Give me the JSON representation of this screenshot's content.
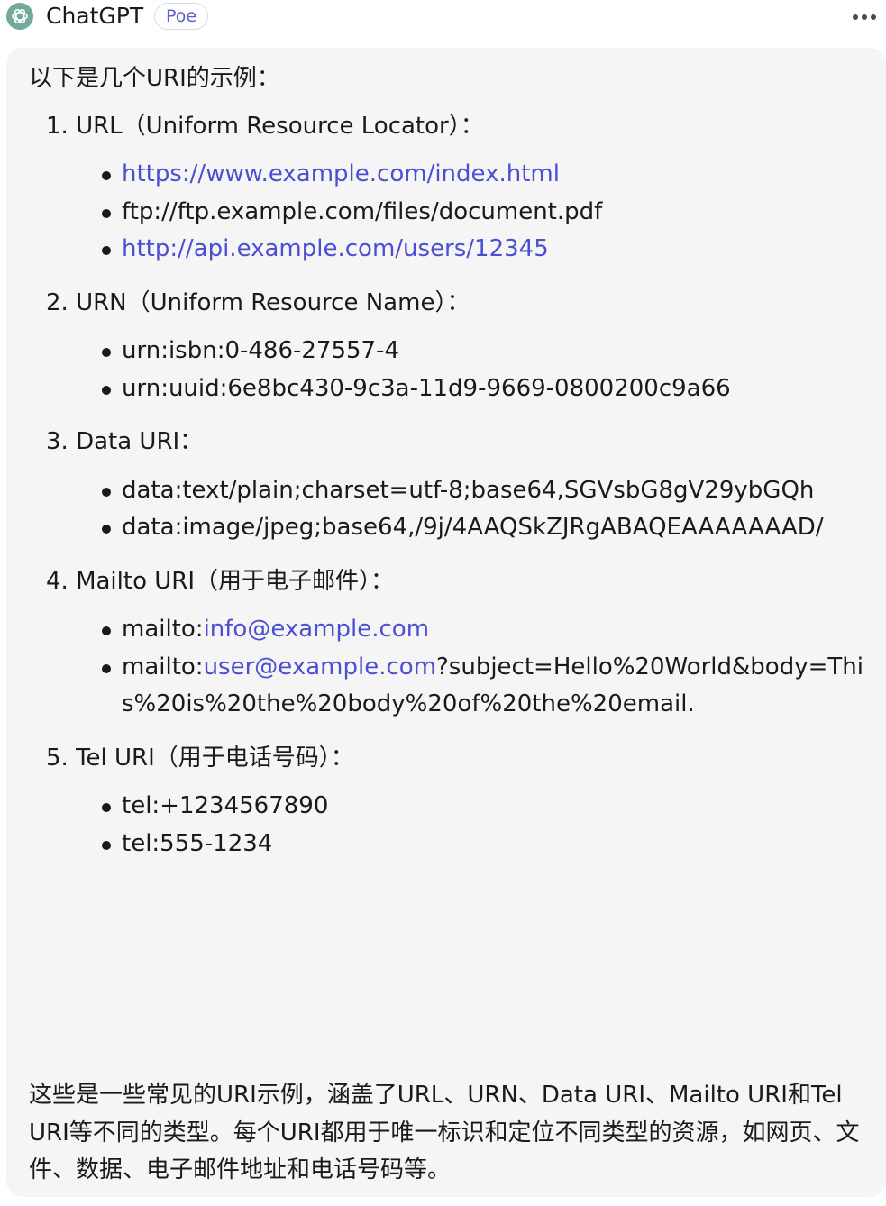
{
  "header": {
    "bot_name": "ChatGPT",
    "badge": "Poe",
    "avatar_icon": "openai-logo-icon",
    "more_icon": "more-horizontal-icon"
  },
  "colors": {
    "link": "#4c4fd2",
    "bubble_bg": "#f5f5f5",
    "avatar_bg": "#74aa9c"
  },
  "message": {
    "intro": "以下是几个URI的示例：",
    "sections": [
      {
        "heading": "1. URL（Uniform Resource Locator）：",
        "items": [
          {
            "text": "https://www.example.com/index.html",
            "is_link": true
          },
          {
            "text": "ftp://ftp.example.com/files/document.pdf",
            "is_link": false
          },
          {
            "text": "http://api.example.com/users/12345",
            "is_link": true
          }
        ]
      },
      {
        "heading": "2. URN（Uniform Resource Name）：",
        "items": [
          {
            "text": "urn:isbn:0-486-27557-4"
          },
          {
            "text": "urn:uuid:6e8bc430-9c3a-11d9-9669-0800200c9a66"
          }
        ]
      },
      {
        "heading": "3. Data URI：",
        "items": [
          {
            "text": "data:text/plain;charset=utf-8;base64,SGVsbG8gV29ybGQh"
          },
          {
            "text": "data:image/jpeg;base64,/9j/4AAQSkZJRgABAQEAAAAAAAD/"
          }
        ]
      },
      {
        "heading": "4. Mailto URI（用于电子邮件）：",
        "items": [
          {
            "prefix": "mailto:",
            "link": "info@example.com",
            "suffix": ""
          },
          {
            "prefix": "mailto:",
            "link": "user@example.com",
            "suffix": "?subject=Hello%20World&body=This%20is%20the%20body%20of%20the%20email."
          }
        ]
      },
      {
        "heading": "5. Tel URI（用于电话号码）：",
        "items": [
          {
            "text": "tel:+1234567890"
          },
          {
            "text": "tel:555-1234"
          }
        ]
      }
    ],
    "summary": "这些是一些常见的URI示例，涵盖了URL、URN、Data URI、Mailto URI和Tel URI等不同的类型。每个URI都用于唯一标识和定位不同类型的资源，如网页、文件、数据、电子邮件地址和电话号码等。"
  }
}
